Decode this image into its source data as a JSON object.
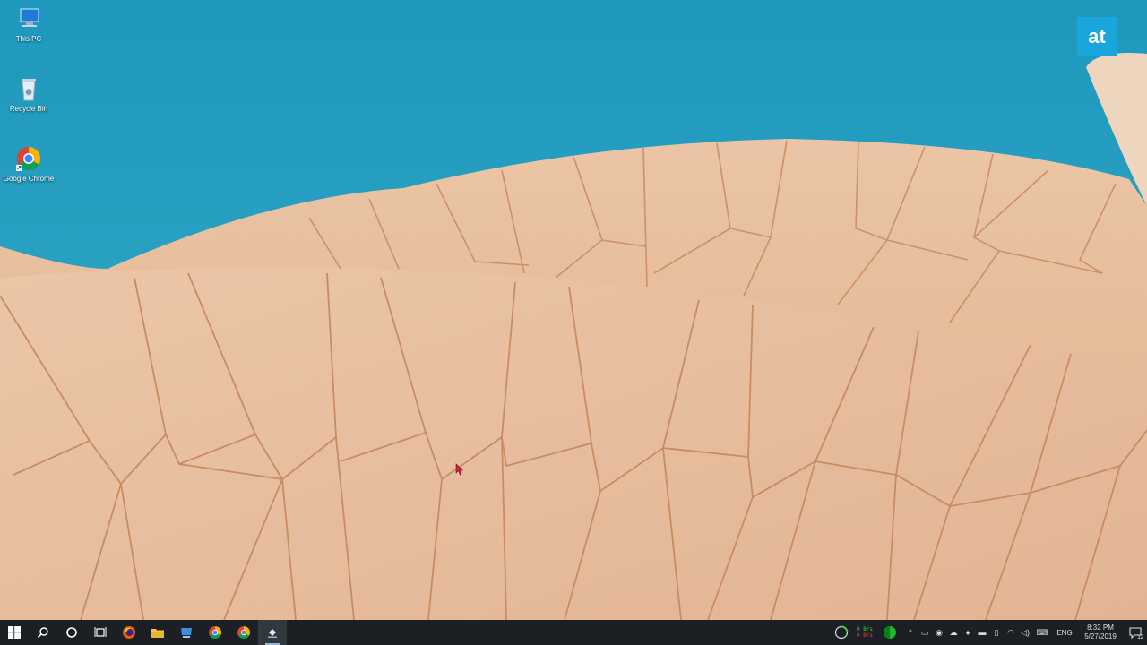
{
  "desktop": {
    "icons": [
      {
        "label": "This PC",
        "icon": "this-pc-icon"
      },
      {
        "label": "Recycle Bin",
        "icon": "recycle-bin-icon"
      },
      {
        "label": "Google Chrome",
        "icon": "chrome-icon"
      }
    ],
    "watermark": "at"
  },
  "taskbar": {
    "pinned": [
      {
        "icon": "start-icon"
      },
      {
        "icon": "search-icon"
      },
      {
        "icon": "cortana-icon"
      },
      {
        "icon": "task-view-icon"
      },
      {
        "icon": "firefox-icon"
      },
      {
        "icon": "file-explorer-icon"
      },
      {
        "icon": "pc-app-icon"
      },
      {
        "icon": "chrome-icon"
      },
      {
        "icon": "chrome-alt-icon"
      },
      {
        "icon": "app-active-icon"
      }
    ],
    "tray": {
      "net_up": "0 B/s",
      "net_down": "0 B/s",
      "language": "ENG",
      "time": "8:32 PM",
      "date": "5/27/2019",
      "notification_count": "12"
    }
  },
  "colors": {
    "sky": "#2aa3c4",
    "shell": "#e8c2a2",
    "seam": "#c98c62",
    "taskbar": "#1c1f24",
    "accent": "#18a6dd"
  }
}
